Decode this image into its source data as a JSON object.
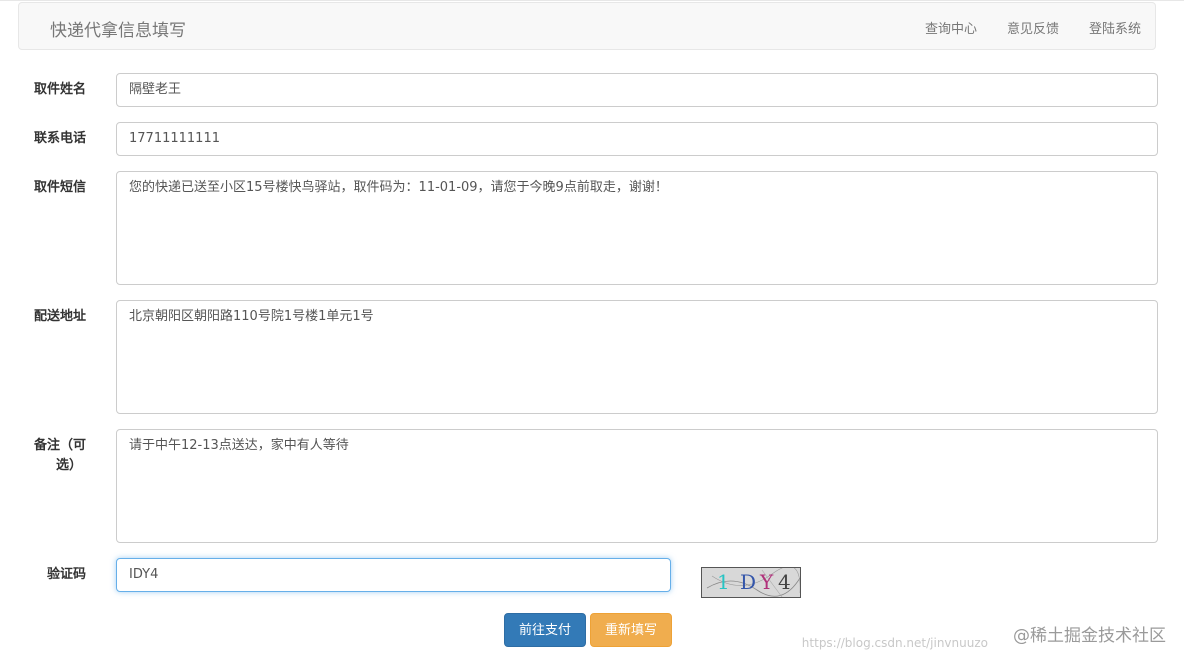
{
  "navbar": {
    "brand": "快递代拿信息填写",
    "links": [
      "查询中心",
      "意见反馈",
      "登陆系统"
    ]
  },
  "form": {
    "name": {
      "label": "取件姓名",
      "value": "隔壁老王"
    },
    "phone": {
      "label": "联系电话",
      "value": "17711111111"
    },
    "sms": {
      "label": "取件短信",
      "value": "您的快递已送至小区15号楼快鸟驿站，取件码为：11-01-09，请您于今晚9点前取走，谢谢！"
    },
    "address": {
      "label": "配送地址",
      "value": "北京朝阳区朝阳路110号院1号楼1单元1号"
    },
    "note": {
      "label_line1": "备注（可",
      "label_line2": "选）",
      "value": "请于中午12-13点送达，家中有人等待"
    },
    "captcha": {
      "label": "验证码",
      "value": "IDY4",
      "image_text": [
        "1",
        "D",
        "Y",
        "4"
      ]
    }
  },
  "buttons": {
    "pay": "前往支付",
    "reset": "重新填写"
  },
  "watermark": {
    "text": "@稀土掘金技术社区",
    "url": "https://blog.csdn.net/jinvnuuzo"
  },
  "colors": {
    "primary": "#337ab7",
    "warning": "#f0ad4e",
    "focus": "#66afe9"
  }
}
